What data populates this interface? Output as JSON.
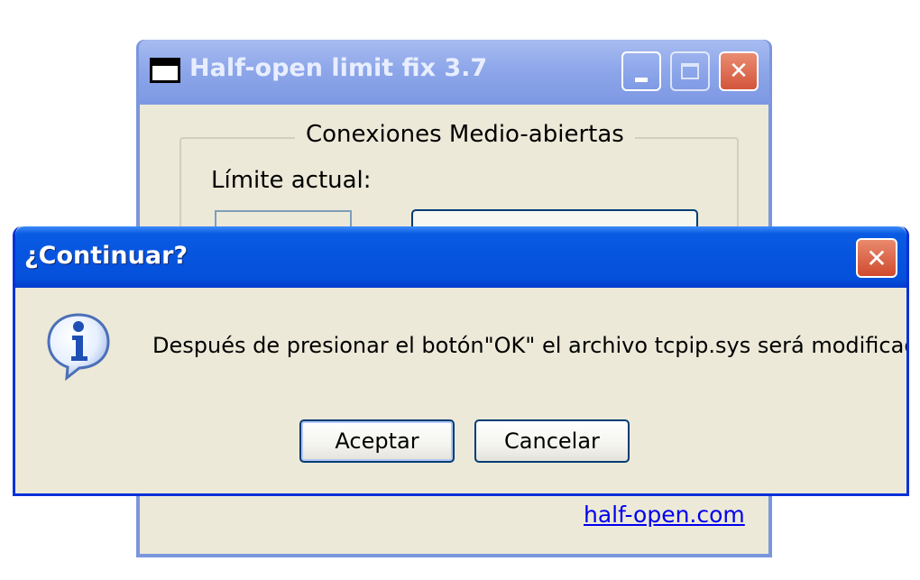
{
  "main_window": {
    "title": "Half-open limit fix 3.7",
    "group_title": "Conexiones Medio-abiertas",
    "limit_label": "Límite actual:",
    "link_text": "half-open.com"
  },
  "dialog": {
    "title": "¿Continuar?",
    "message": "Después de presionar el botón\"OK\" el archivo tcpip.sys será modificado",
    "accept_label": "Aceptar",
    "cancel_label": "Cancelar",
    "close_glyph": "✕",
    "icon": "info-icon"
  },
  "colors": {
    "dialog_title_bg": "#0654df",
    "window_face": "#ece9d8",
    "link": "#0000ee"
  }
}
